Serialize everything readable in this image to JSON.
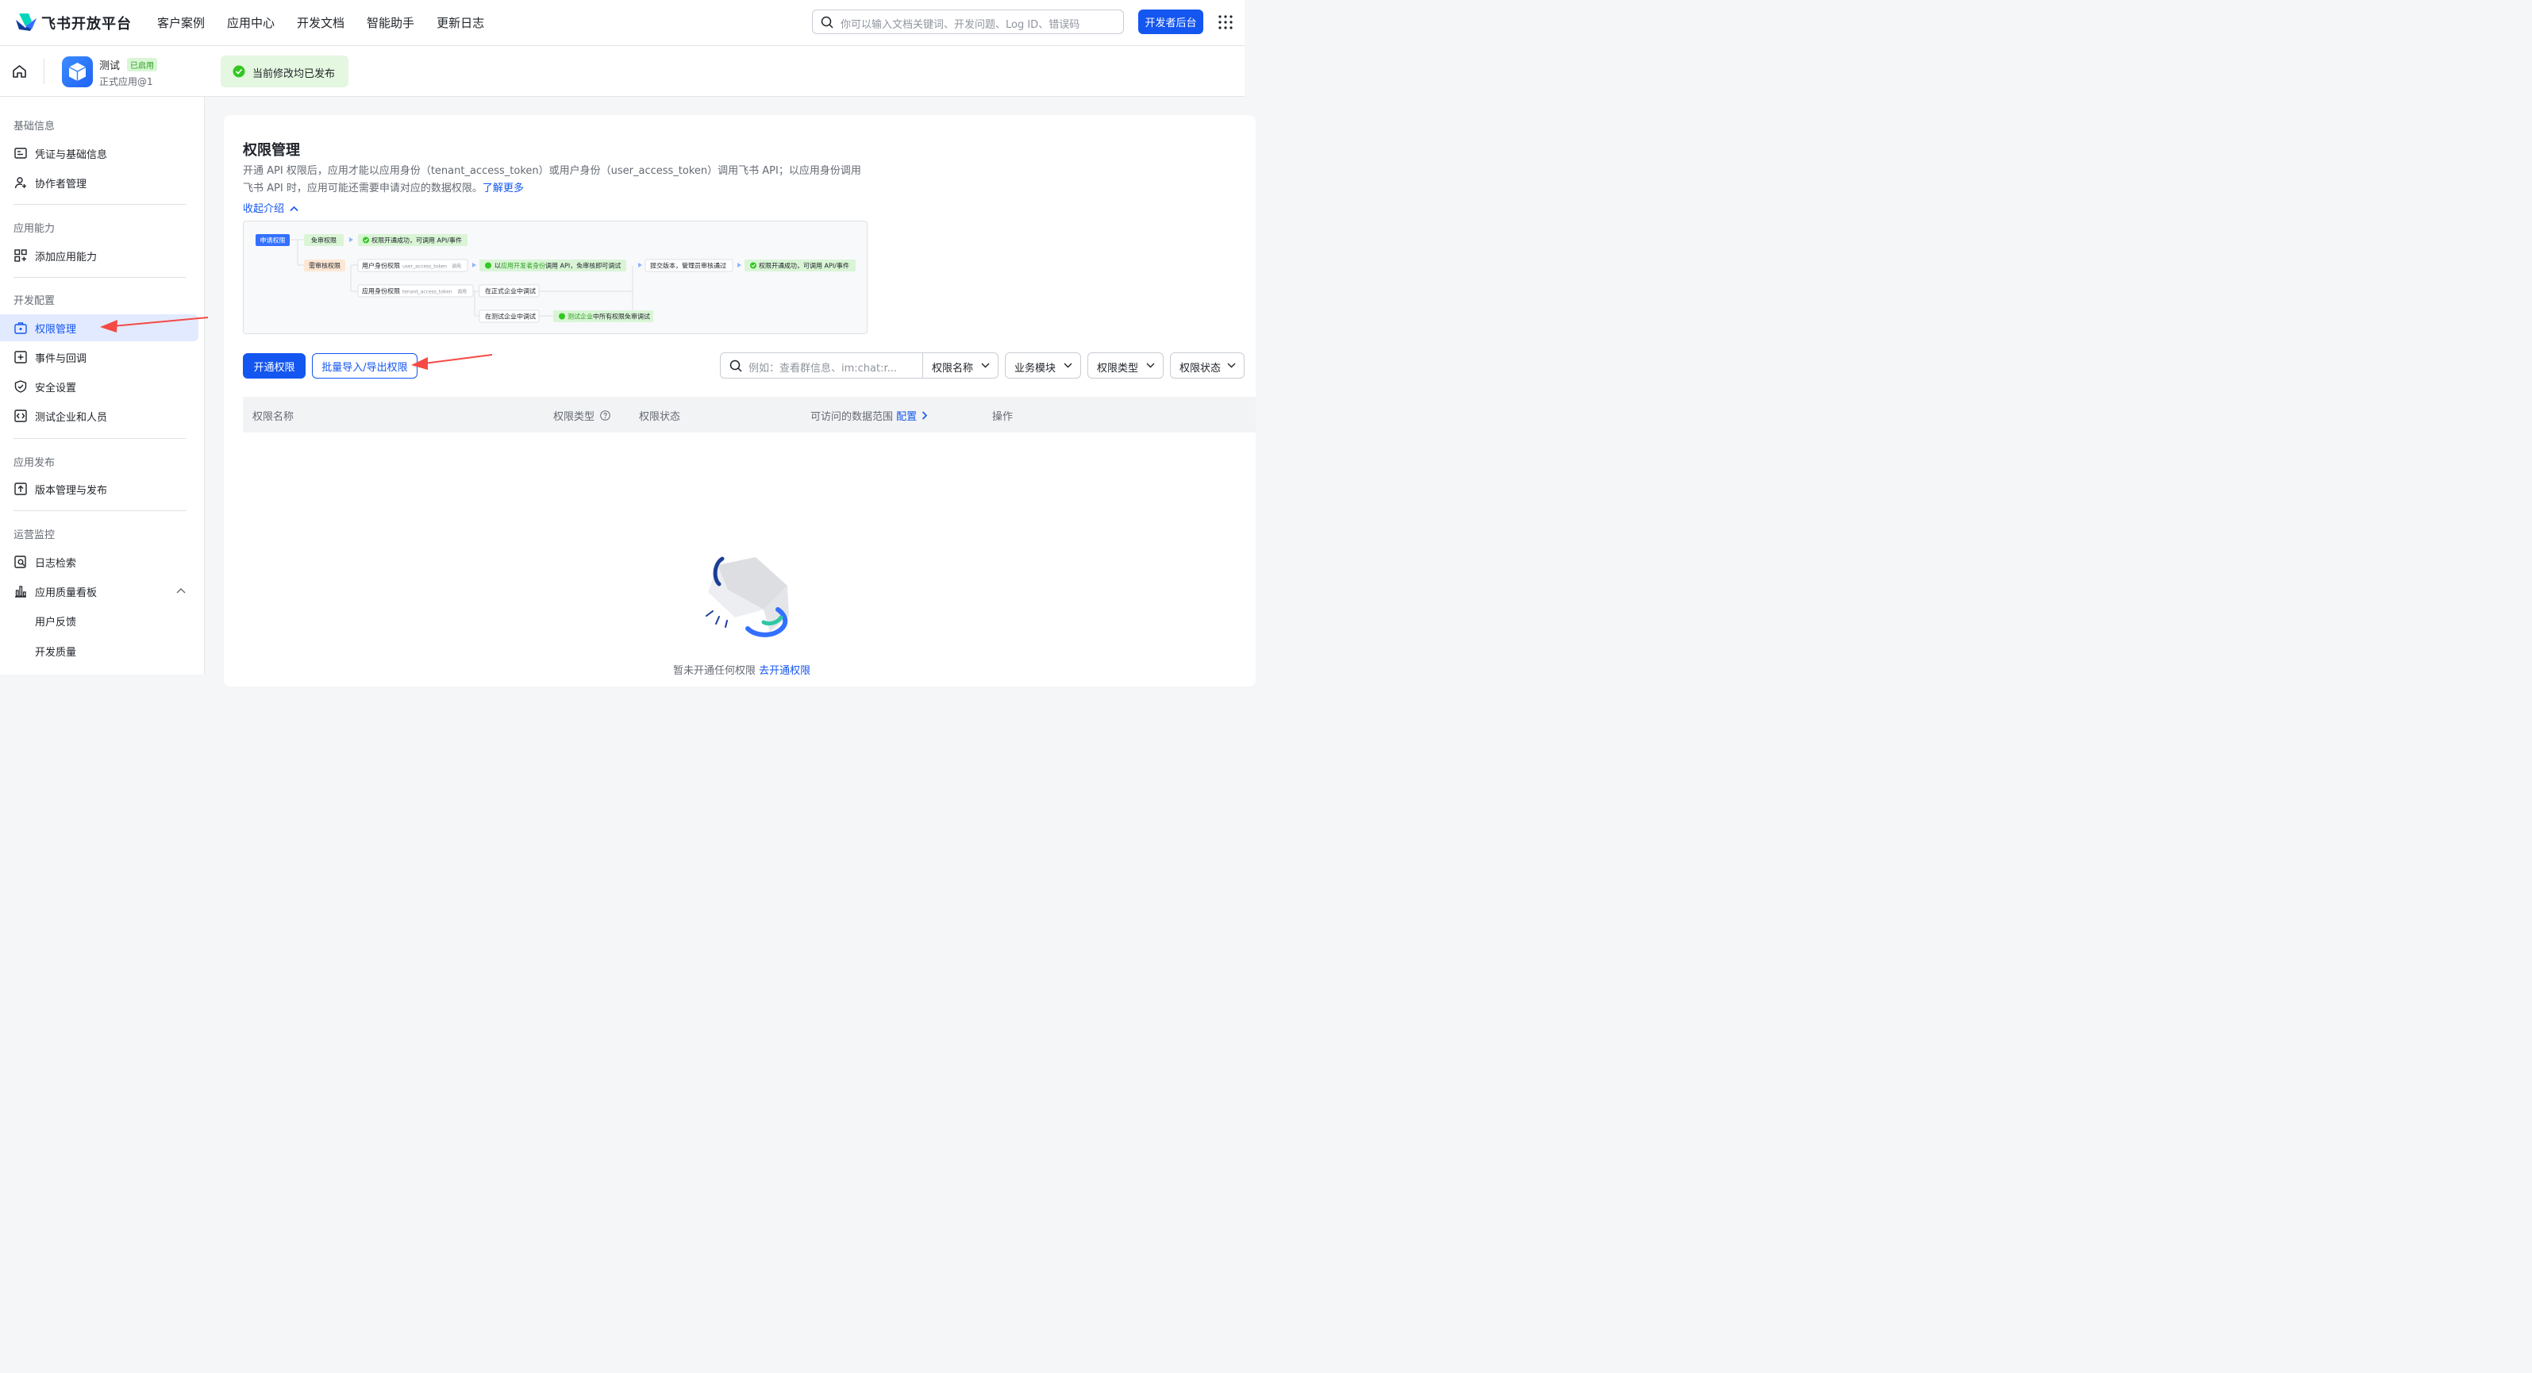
{
  "topbar": {
    "brand": "飞书开放平台",
    "nav": [
      "客户案例",
      "应用中心",
      "开发文档",
      "智能助手",
      "更新日志"
    ],
    "search_placeholder": "你可以输入文档关键词、开发问题、Log ID、错误码",
    "dev_console": "开发者后台"
  },
  "app": {
    "name": "测试",
    "status_badge": "已启用",
    "version": "正式应用@1",
    "publish_status": "当前修改均已发布"
  },
  "sidebar": {
    "sections": [
      {
        "title": "基础信息",
        "items": [
          "凭证与基础信息",
          "协作者管理"
        ]
      },
      {
        "title": "应用能力",
        "items": [
          "添加应用能力"
        ]
      },
      {
        "title": "开发配置",
        "items": [
          "权限管理",
          "事件与回调",
          "安全设置",
          "测试企业和人员"
        ]
      },
      {
        "title": "应用发布",
        "items": [
          "版本管理与发布"
        ]
      },
      {
        "title": "运营监控",
        "items": [
          "日志检索",
          "应用质量看板",
          "用户反馈",
          "开发质量"
        ]
      }
    ]
  },
  "main": {
    "title": "权限管理",
    "description": "开通 API 权限后，应用才能以应用身份（tenant_access_token）或用户身份（user_access_token）调用飞书 API；以应用身份调用飞书 API 时，应用可能还需要申请对应的数据权限。",
    "learn_more": "了解更多",
    "collapse_intro": "收起介绍",
    "flow": {
      "apply": "申请权限",
      "free": "免审权限",
      "free_result": "权限开通成功，可调用 API/事件",
      "review": "需审核权限",
      "user_identity": "用户身份权限",
      "user_token": "user_access_token",
      "call": "调用",
      "dev_identity_prefix": "以",
      "dev_identity_highlight": "应用开发者身份",
      "dev_identity_suffix": "调用 API，免审核即可调试",
      "submit": "提交版本，管理员审核通过",
      "final_result": "权限开通成功，可调用 API/事件",
      "app_identity": "应用身份权限",
      "tenant_token": "tenant_access_token",
      "formal_debug": "在正式企业中调试",
      "test_debug": "在测试企业中调试",
      "test_free_highlight": "测试企业",
      "test_free_suffix": "中所有权限免审调试"
    },
    "btn_open": "开通权限",
    "btn_batch": "批量导入/导出权限",
    "filter_placeholder": "例如：查看群信息、im:chat:r...",
    "filters": [
      "权限名称",
      "业务模块",
      "权限类型",
      "权限状态"
    ],
    "table_headers": {
      "name": "权限名称",
      "type": "权限类型",
      "status": "权限状态",
      "scope": "可访问的数据范围",
      "config": "配置",
      "ops": "操作"
    },
    "empty_text": "暂未开通任何权限",
    "empty_link": "去开通权限"
  }
}
